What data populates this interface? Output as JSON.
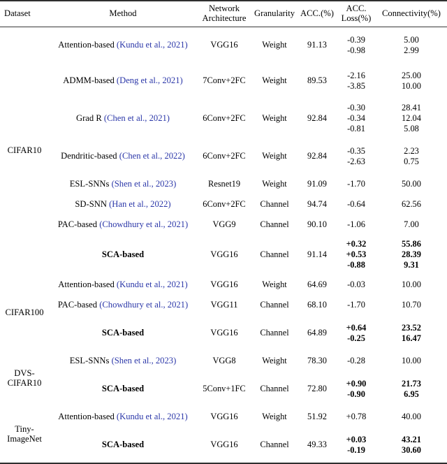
{
  "table": {
    "columns": [
      {
        "key": "dataset",
        "label": "Dataset"
      },
      {
        "key": "method",
        "label": "Method"
      },
      {
        "key": "arch",
        "label_line1": "Network",
        "label_line2": "Architecture"
      },
      {
        "key": "granularity",
        "label": "Granularity"
      },
      {
        "key": "acc",
        "label": "ACC.(%)"
      },
      {
        "key": "acc_loss",
        "label_line1": "ACC.",
        "label_line2": "Loss(%)"
      },
      {
        "key": "connectivity",
        "label": "Connectivity(%)"
      }
    ],
    "cite_color": "#2a36a8",
    "groups": [
      {
        "dataset": "CIFAR10",
        "rows": [
          {
            "method_name": "Attention-based",
            "method_cite": "(Kundu et al., 2021)",
            "arch": "VGG16",
            "granularity": "Weight",
            "acc": "91.13",
            "acc_loss": [
              "-0.39",
              "-0.98"
            ],
            "connectivity": [
              "5.00",
              "2.99"
            ],
            "ours": false
          },
          {
            "method_name": "ADMM-based",
            "method_cite": "(Deng et al., 2021)",
            "arch": "7Conv+2FC",
            "granularity": "Weight",
            "acc": "89.53",
            "acc_loss": [
              "-2.16",
              "-3.85"
            ],
            "connectivity": [
              "25.00",
              "10.00"
            ],
            "ours": false
          },
          {
            "method_name": "Grad R",
            "method_cite": "(Chen et al., 2021)",
            "arch": "6Conv+2FC",
            "granularity": "Weight",
            "acc": "92.84",
            "acc_loss": [
              "-0.30",
              "-0.34",
              "-0.81"
            ],
            "connectivity": [
              "28.41",
              "12.04",
              "5.08"
            ],
            "ours": false
          },
          {
            "method_name": "Dendritic-based",
            "method_cite": "(Chen et al., 2022)",
            "arch": "6Conv+2FC",
            "granularity": "Weight",
            "acc": "92.84",
            "acc_loss": [
              "-0.35",
              "-2.63"
            ],
            "connectivity": [
              "2.23",
              "0.75"
            ],
            "ours": false
          },
          {
            "method_name": "ESL-SNNs",
            "method_cite": "(Shen et al., 2023)",
            "arch": "Resnet19",
            "granularity": "Weight",
            "acc": "91.09",
            "acc_loss": [
              "-1.70"
            ],
            "connectivity": [
              "50.00"
            ],
            "ours": false
          },
          {
            "method_name": "SD-SNN",
            "method_cite": "(Han et al., 2022)",
            "arch": "6Conv+2FC",
            "granularity": "Channel",
            "acc": "94.74",
            "acc_loss": [
              "-0.64"
            ],
            "connectivity": [
              "62.56"
            ],
            "ours": false
          },
          {
            "method_name": "PAC-based",
            "method_cite": "(Chowdhury et al., 2021)",
            "arch": "VGG9",
            "granularity": "Channel",
            "acc": "90.10",
            "acc_loss": [
              "-1.06"
            ],
            "connectivity": [
              "7.00"
            ],
            "ours": false
          },
          {
            "method_name": "SCA-based",
            "method_cite": "",
            "arch": "VGG16",
            "granularity": "Channel",
            "acc": "91.14",
            "acc_loss": [
              "+0.32",
              "+0.53",
              "-0.88"
            ],
            "connectivity": [
              "55.86",
              "28.39",
              "9.31"
            ],
            "ours": true
          }
        ]
      },
      {
        "dataset": "CIFAR100",
        "rows": [
          {
            "method_name": "Attention-based",
            "method_cite": "(Kundu et al., 2021)",
            "arch": "VGG16",
            "granularity": "Weight",
            "acc": "64.69",
            "acc_loss": [
              "-0.03"
            ],
            "connectivity": [
              "10.00"
            ],
            "ours": false
          },
          {
            "method_name": "PAC-based",
            "method_cite": "(Chowdhury et al., 2021)",
            "arch": "VGG11",
            "granularity": "Channel",
            "acc": "68.10",
            "acc_loss": [
              "-1.70"
            ],
            "connectivity": [
              "10.70"
            ],
            "ours": false
          },
          {
            "method_name": "SCA-based",
            "method_cite": "",
            "arch": "VGG16",
            "granularity": "Channel",
            "acc": "64.89",
            "acc_loss": [
              "+0.64",
              "-0.25"
            ],
            "connectivity": [
              "23.52",
              "16.47"
            ],
            "ours": true
          }
        ]
      },
      {
        "dataset": "DVS-\nCIFAR10",
        "dataset_line1": "DVS-",
        "dataset_line2": "CIFAR10",
        "rows": [
          {
            "method_name": "ESL-SNNs",
            "method_cite": "(Shen et al., 2023)",
            "arch": "VGG8",
            "granularity": "Weight",
            "acc": "78.30",
            "acc_loss": [
              "-0.28"
            ],
            "connectivity": [
              "10.00"
            ],
            "ours": false
          },
          {
            "method_name": "SCA-based",
            "method_cite": "",
            "arch": "5Conv+1FC",
            "granularity": "Channel",
            "acc": "72.80",
            "acc_loss": [
              "+0.90",
              "-0.90"
            ],
            "connectivity": [
              "21.73",
              "6.95"
            ],
            "ours": true
          }
        ]
      },
      {
        "dataset": "Tiny-\nImageNet",
        "dataset_line1": "Tiny-",
        "dataset_line2": "ImageNet",
        "rows": [
          {
            "method_name": "Attention-based",
            "method_cite": "(Kundu et al., 2021)",
            "arch": "VGG16",
            "granularity": "Weight",
            "acc": "51.92",
            "acc_loss": [
              "+0.78"
            ],
            "connectivity": [
              "40.00"
            ],
            "ours": false
          },
          {
            "method_name": "SCA-based",
            "method_cite": "",
            "arch": "VGG16",
            "granularity": "Channel",
            "acc": "49.33",
            "acc_loss": [
              "+0.03",
              "-0.19"
            ],
            "connectivity": [
              "43.21",
              "30.60"
            ],
            "ours": true
          }
        ]
      }
    ]
  }
}
